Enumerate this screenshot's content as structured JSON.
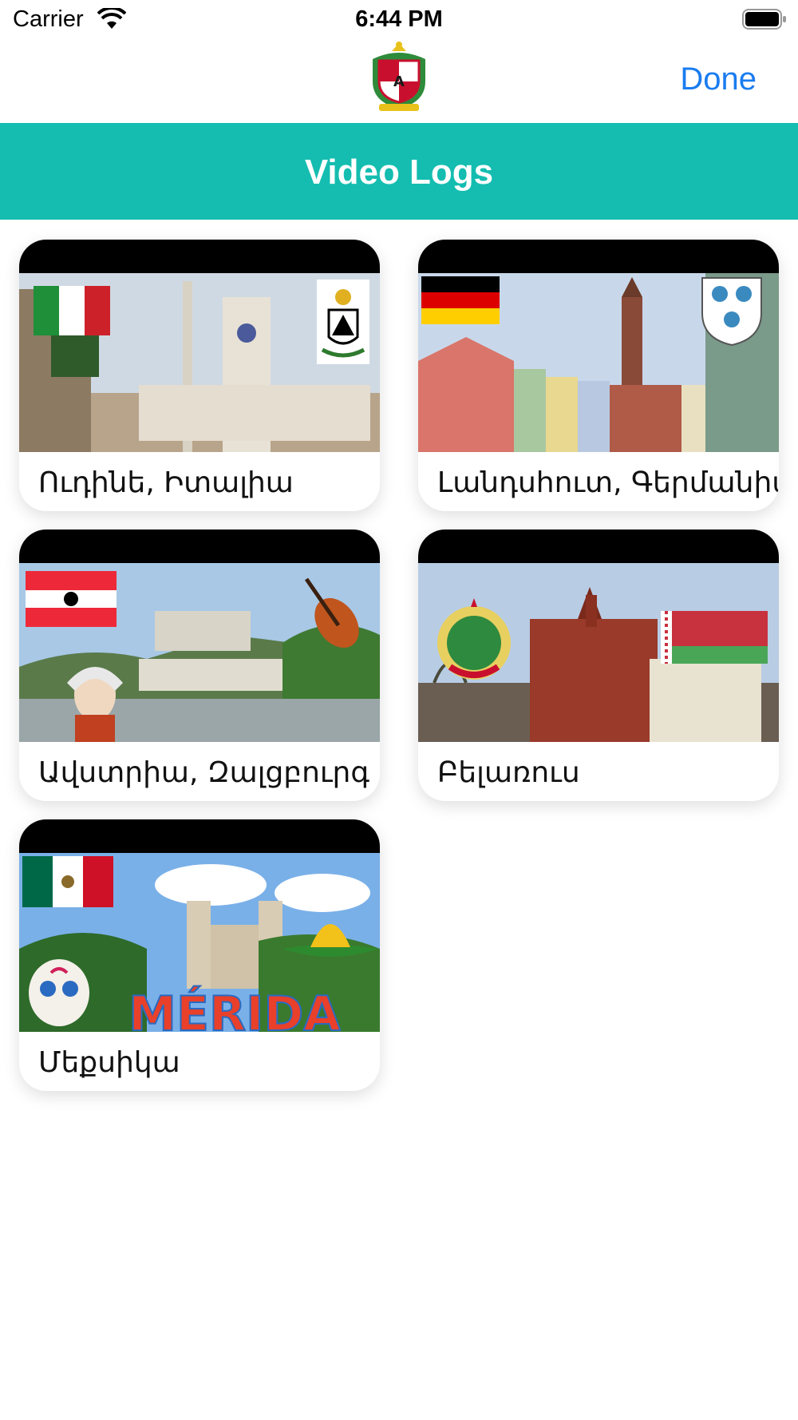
{
  "status_bar": {
    "carrier": "Carrier",
    "time": "6:44 PM"
  },
  "nav": {
    "done_label": "Done",
    "logo_icon": "coat-of-arms-icon"
  },
  "banner": {
    "title": "Video Logs",
    "color": "#14bdb0"
  },
  "cards": [
    {
      "label": "Ուդինե, Իտալիա",
      "flag": "italy-flag-icon"
    },
    {
      "label": "Լանդսհուտ, Գերմանիա",
      "flag": "germany-flag-icon"
    },
    {
      "label": "Ավստրիա, Զալցբուրգ",
      "flag": "austria-flag-icon"
    },
    {
      "label": "Բելառուս",
      "flag": "belarus-flag-icon"
    },
    {
      "label": "Մեքսիկա",
      "flag": "mexico-flag-icon",
      "sign_text": "MÉRIDA"
    }
  ],
  "colors": {
    "accent_link": "#1a7cf0"
  }
}
